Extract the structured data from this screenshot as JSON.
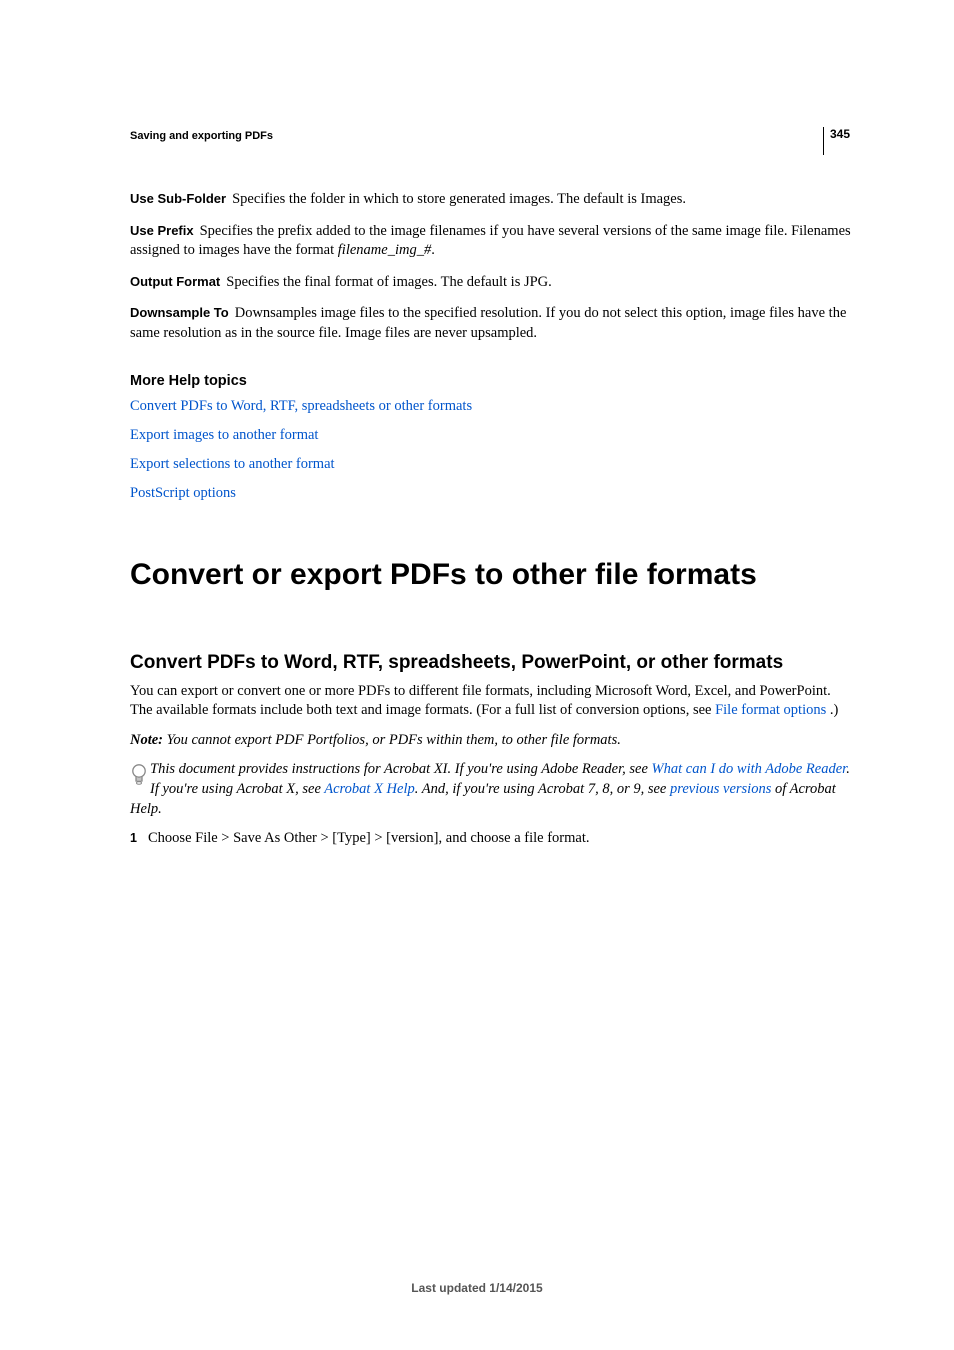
{
  "page_number": "345",
  "section_header": "Saving and exporting PDFs",
  "options": {
    "use_subfolder": {
      "label": "Use Sub-Folder",
      "desc": "Specifies the folder in which to store generated images. The default is Images."
    },
    "use_prefix": {
      "label": "Use Prefix",
      "desc_pre": "Specifies the prefix added to the image filenames if you have several versions of the same image file. Filenames assigned to images have the format ",
      "desc_italic": "filename_img_#",
      "desc_post": "."
    },
    "output_format": {
      "label": "Output Format",
      "desc": "Specifies the final format of images. The default is JPG."
    },
    "downsample_to": {
      "label": "Downsample To",
      "desc": "Downsamples image files to the specified resolution. If you do not select this option, image files have the same resolution as in the source file. Image files are never upsampled."
    }
  },
  "more_help": {
    "heading": "More Help topics",
    "links": [
      "Convert PDFs to Word, RTF, spreadsheets or other formats",
      "Export images to another format",
      "Export selections to another format",
      "PostScript options"
    ]
  },
  "h1": "Convert or export PDFs to other file formats",
  "h2": "Convert PDFs to Word, RTF, spreadsheets, PowerPoint, or other formats",
  "body1_pre": "You can export or convert one or more PDFs to different file formats, including Microsoft Word, Excel, and PowerPoint. The available formats include both text and image formats. (For a full list of conversion options, see ",
  "body1_link": "File format options ",
  "body1_post": ".)",
  "note": {
    "label": "Note: ",
    "text": "You cannot export PDF Portfolios, or PDFs within them, to other file formats."
  },
  "tip": {
    "seg1": "This document provides instructions for Acrobat XI. If you're using Adobe Reader, see ",
    "link1": "What can I do with Adobe Reader",
    "seg2": ". If you're using Acrobat X, see ",
    "link2": "Acrobat X Help",
    "seg3": ". And, if you're using Acrobat 7, 8, or 9, see ",
    "link3": "previous versions",
    "seg4": " of Acrobat Help."
  },
  "step1": {
    "num": "1",
    "text": "Choose File > Save As Other > [Type] > [version], and choose a file format."
  },
  "footer": "Last updated 1/14/2015"
}
